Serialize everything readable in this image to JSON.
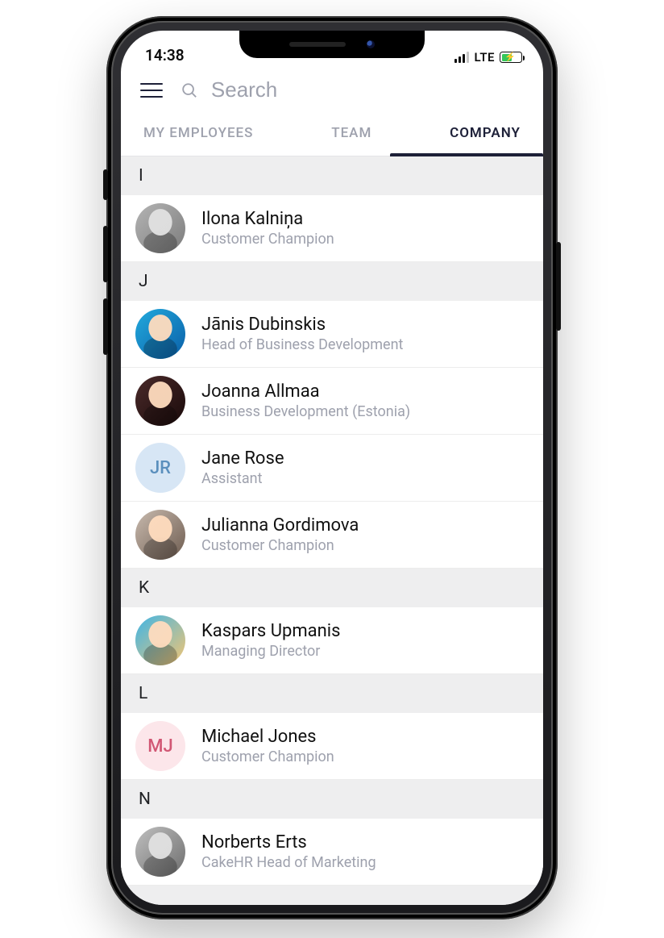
{
  "status": {
    "time": "14:38",
    "network": "LTE"
  },
  "header": {
    "search_placeholder": "Search"
  },
  "tabs": {
    "items": [
      {
        "label": "MY EMPLOYEES",
        "active": false
      },
      {
        "label": "TEAM",
        "active": false
      },
      {
        "label": "COMPANY",
        "active": true
      }
    ]
  },
  "sections": [
    {
      "letter": "I",
      "people": [
        {
          "name": "Ilona Kalniņa",
          "title": "Customer Champion",
          "avatar_type": "photo",
          "avatar_class": "av-photo-1",
          "initials": ""
        }
      ]
    },
    {
      "letter": "J",
      "people": [
        {
          "name": "Jānis Dubinskis",
          "title": "Head of Business Development",
          "avatar_type": "photo",
          "avatar_class": "av-photo-2",
          "initials": ""
        },
        {
          "name": "Joanna Allmaa",
          "title": "Business Development (Estonia)",
          "avatar_type": "photo",
          "avatar_class": "av-photo-3",
          "initials": ""
        },
        {
          "name": "Jane Rose",
          "title": "Assistant",
          "avatar_type": "initials",
          "avatar_class": "av-initials-jr",
          "initials": "JR"
        },
        {
          "name": "Julianna Gordimova",
          "title": "Customer Champion",
          "avatar_type": "photo",
          "avatar_class": "av-photo-5",
          "initials": ""
        }
      ]
    },
    {
      "letter": "K",
      "people": [
        {
          "name": "Kaspars Upmanis",
          "title": "Managing Director",
          "avatar_type": "photo",
          "avatar_class": "av-photo-6",
          "initials": ""
        }
      ]
    },
    {
      "letter": "L",
      "people": [
        {
          "name": "Michael Jones",
          "title": "Customer Champion",
          "avatar_type": "initials",
          "avatar_class": "av-initials-mj",
          "initials": "MJ"
        }
      ]
    },
    {
      "letter": "N",
      "people": [
        {
          "name": "Norberts Erts",
          "title": "CakeHR Head of Marketing",
          "avatar_type": "photo",
          "avatar_class": "av-photo-8",
          "initials": ""
        }
      ]
    }
  ]
}
